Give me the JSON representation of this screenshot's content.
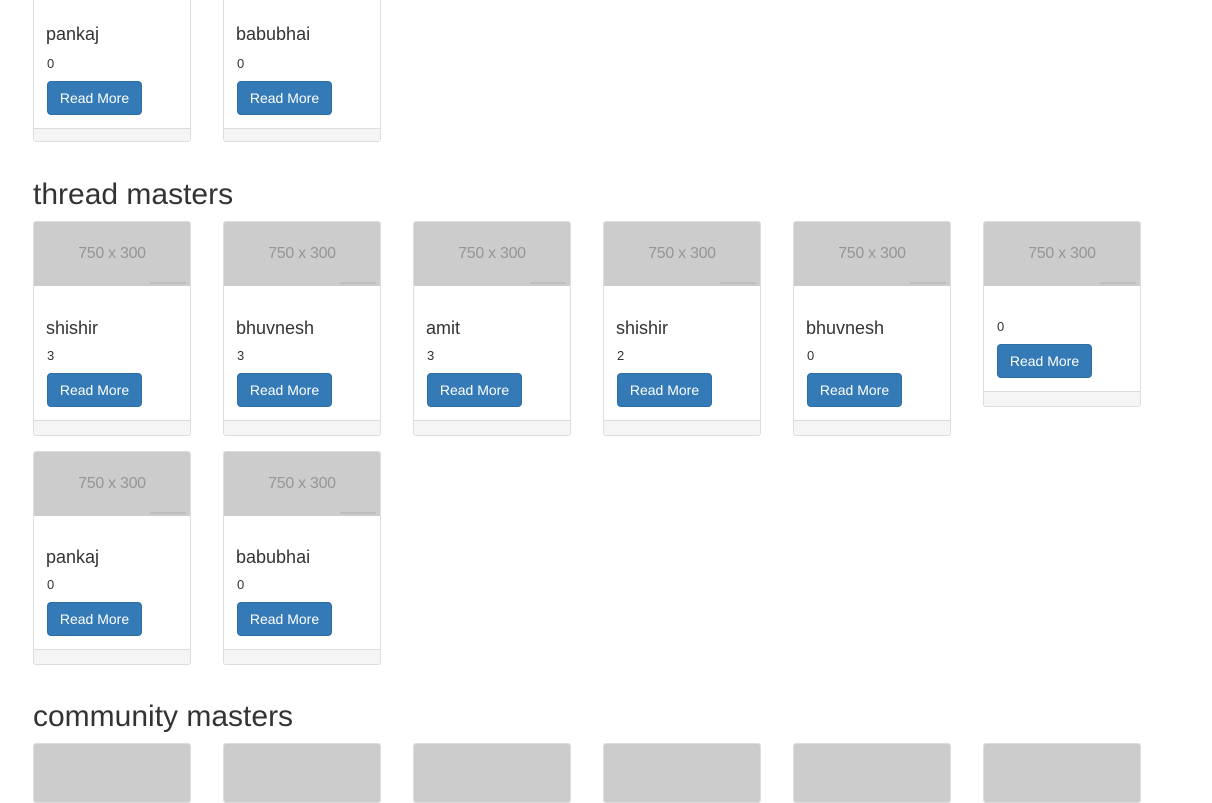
{
  "image_placeholder_text": "750 x 300",
  "top_partial_cards": [
    {
      "name": "pankaj",
      "count": "0",
      "button": "Read More"
    },
    {
      "name": "babubhai",
      "count": "0",
      "button": "Read More"
    }
  ],
  "thread_masters": {
    "title": "thread masters",
    "cards": [
      {
        "name": "shishir",
        "count": "3",
        "button": "Read More"
      },
      {
        "name": "bhuvnesh",
        "count": "3",
        "button": "Read More"
      },
      {
        "name": "amit",
        "count": "3",
        "button": "Read More"
      },
      {
        "name": "shishir",
        "count": "2",
        "button": "Read More"
      },
      {
        "name": "bhuvnesh",
        "count": "0",
        "button": "Read More"
      },
      {
        "name": "",
        "count": "0",
        "button": "Read More"
      },
      {
        "name": "pankaj",
        "count": "0",
        "button": "Read More"
      },
      {
        "name": "babubhai",
        "count": "0",
        "button": "Read More"
      }
    ]
  },
  "community_masters": {
    "title": "community masters"
  }
}
